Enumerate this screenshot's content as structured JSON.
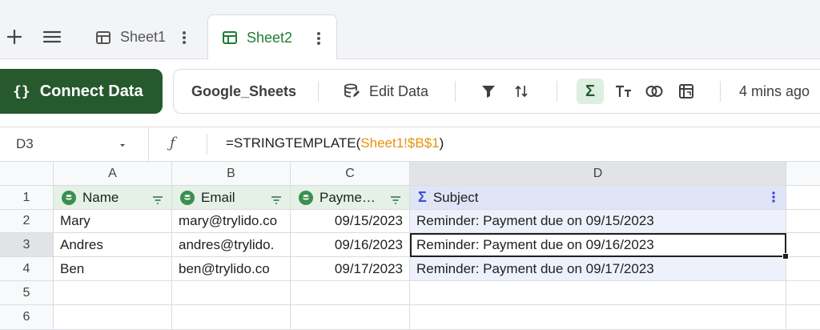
{
  "tabbar": {
    "tabs": [
      {
        "label": "Sheet1",
        "active": false
      },
      {
        "label": "Sheet2",
        "active": true
      }
    ]
  },
  "toolbar": {
    "connect_label": "Connect Data",
    "source_name": "Google_Sheets",
    "edit_data_label": "Edit Data",
    "last_saved": "4 mins ago"
  },
  "formula_bar": {
    "cell_ref": "D3",
    "formula_prefix": "=STRINGTEMPLATE(",
    "formula_ref": "Sheet1!$B$1",
    "formula_suffix": ")"
  },
  "grid": {
    "columns": [
      "A",
      "B",
      "C",
      "D"
    ],
    "rows": [
      "1",
      "2",
      "3",
      "4",
      "5",
      "6"
    ],
    "header_row": {
      "a": "Name",
      "b": "Email",
      "c": "Payme…",
      "d": "Subject"
    },
    "data": [
      {
        "name": "Mary",
        "email": "mary@trylido.co",
        "payment": "09/15/2023",
        "subject": "Reminder: Payment due on 09/15/2023"
      },
      {
        "name": "Andres",
        "email": "andres@trylido.",
        "payment": "09/16/2023",
        "subject": "Reminder: Payment due on 09/16/2023"
      },
      {
        "name": "Ben",
        "email": "ben@trylido.co",
        "payment": "09/17/2023",
        "subject": "Reminder: Payment due on 09/17/2023"
      }
    ]
  },
  "colors": {
    "accent_green": "#26592e",
    "active_tab_text": "#1e7e34",
    "source_header_bg": "#e5f1e7",
    "formula_header_bg": "#e0e4f7",
    "formula_ref": "#e8910c"
  },
  "icons": [
    "plus-icon",
    "menu-icon",
    "table-icon",
    "kebab-icon",
    "braces-icon",
    "database-icon",
    "filter-icon",
    "sort-icon",
    "sigma-icon",
    "text-format-icon",
    "join-icon",
    "pivot-icon",
    "function-icon",
    "caret-down-icon"
  ]
}
